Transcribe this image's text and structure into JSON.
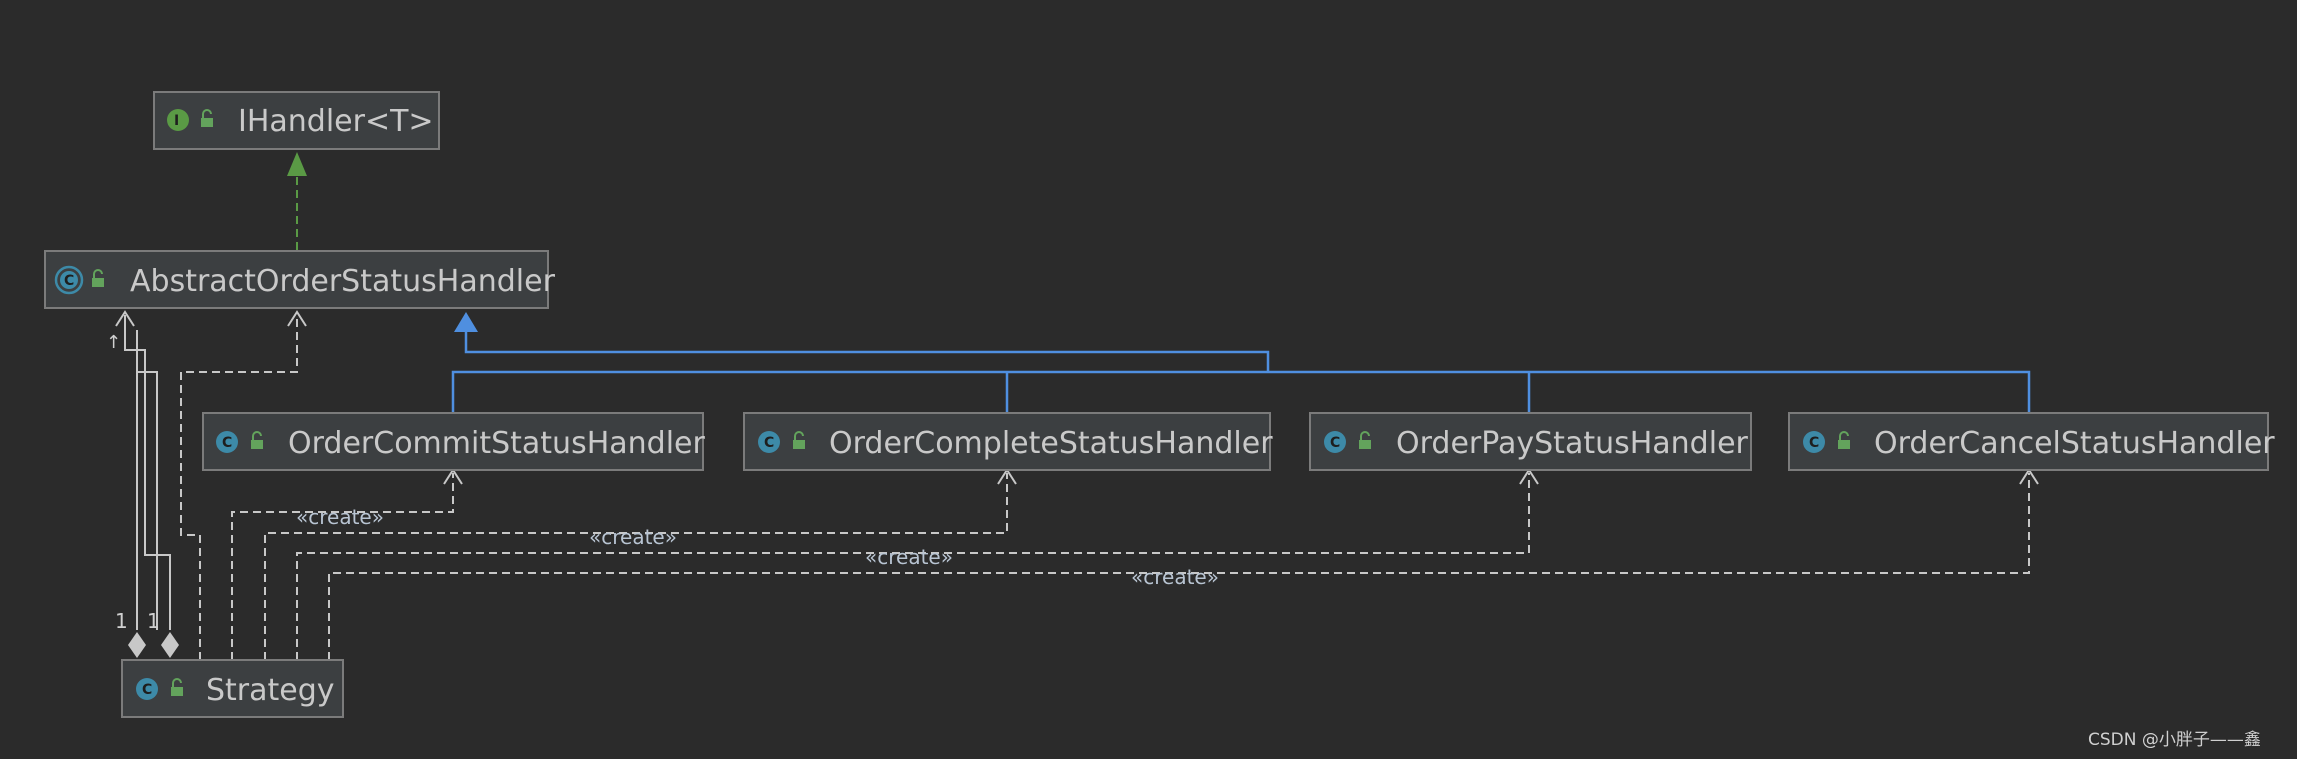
{
  "nodes": {
    "ihandler": {
      "name": "IHandler<T>",
      "kind": "interface",
      "kind_letter": "I",
      "icon": "interface-icon"
    },
    "abstract": {
      "name": "AbstractOrderStatusHandler",
      "kind": "abstract-class",
      "kind_letter": "C",
      "icon": "abstract-class-icon"
    },
    "commit": {
      "name": "OrderCommitStatusHandler",
      "kind": "class",
      "kind_letter": "C",
      "icon": "class-icon"
    },
    "complete": {
      "name": "OrderCompleteStatusHandler",
      "kind": "class",
      "kind_letter": "C",
      "icon": "class-icon"
    },
    "pay": {
      "name": "OrderPayStatusHandler",
      "kind": "class",
      "kind_letter": "C",
      "icon": "class-icon"
    },
    "cancel": {
      "name": "OrderCancelStatusHandler",
      "kind": "class",
      "kind_letter": "C",
      "icon": "class-icon"
    },
    "strategy": {
      "name": "Strategy",
      "kind": "class",
      "kind_letter": "C",
      "icon": "class-icon"
    }
  },
  "edges": {
    "create_label": "«create»",
    "multiplicity_left": "1",
    "multiplicity_right": "1"
  },
  "colors": {
    "background": "#2b2b2b",
    "box_fill": "#3c3f41",
    "box_border": "#7b7b7b",
    "text": "#c9c9c9",
    "extends_line": "#4f8fe0",
    "realize_line": "#5a9a45",
    "create_line": "#c8c8c8"
  },
  "watermark": "CSDN @小胖子——鑫"
}
